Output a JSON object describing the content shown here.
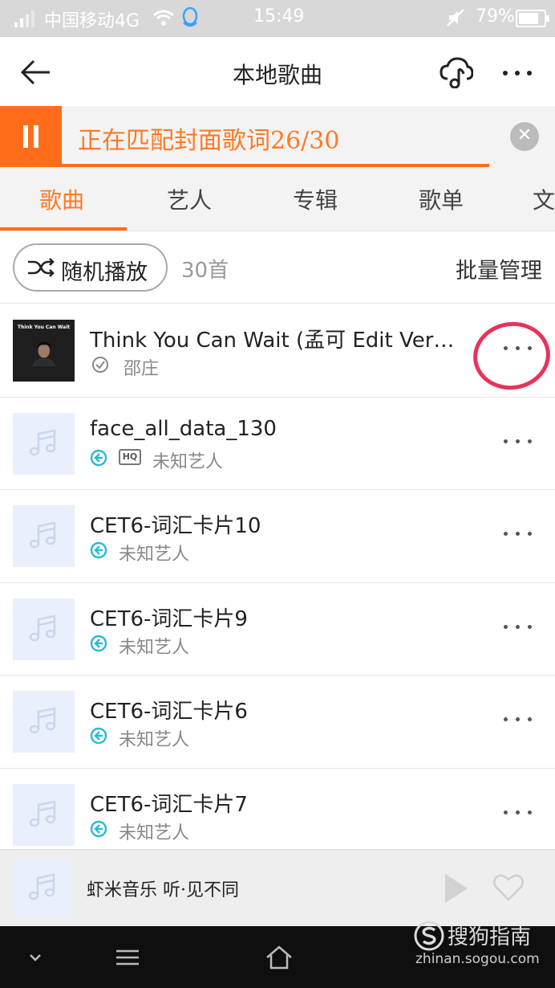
{
  "status_bar": {
    "carrier": "中国移动4G",
    "time": "15:49",
    "battery": "79%",
    "battery_level": 0.79
  },
  "header": {
    "title": "本地歌曲",
    "icons": [
      "back-arrow-icon",
      "cloud-music-icon",
      "more-icon"
    ]
  },
  "match_bar": {
    "text": "正在匹配封面歌词26/30",
    "progress": 0.867
  },
  "tabs": [
    {
      "label": "歌曲",
      "active": true
    },
    {
      "label": "艺人"
    },
    {
      "label": "专辑"
    },
    {
      "label": "歌单"
    },
    {
      "label": "文"
    }
  ],
  "toolbar": {
    "shuffle_label": "随机播放",
    "count": "30首",
    "batch_label": "批量管理"
  },
  "songs": [
    {
      "title": "Think You Can Wait (孟可 Edit Ver…",
      "artist": "邵庄",
      "cover_text": "Think You Can Wait",
      "status_icon": "check-icon",
      "hq": false
    },
    {
      "title": "face_all_data_130",
      "artist": "未知艺人",
      "status_icon": "local-icon",
      "hq": true,
      "hq_label": "HQ"
    },
    {
      "title": "CET6-词汇卡片10",
      "artist": "未知艺人",
      "status_icon": "local-icon",
      "hq": false
    },
    {
      "title": "CET6-词汇卡片9",
      "artist": "未知艺人",
      "status_icon": "local-icon",
      "hq": false
    },
    {
      "title": "CET6-词汇卡片6",
      "artist": "未知艺人",
      "status_icon": "local-icon",
      "hq": false
    },
    {
      "title": "CET6-词汇卡片7",
      "artist": "未知艺人",
      "status_icon": "local-icon",
      "hq": false
    }
  ],
  "player": {
    "slogan": "虾米音乐 听·见不同"
  },
  "watermark": {
    "name": "搜狗指南",
    "url": "zhinan.sogou.com"
  },
  "colors": {
    "accent": "#ff6d1a",
    "accent_text": "#ff7a24",
    "local_icon": "#2bb8d8",
    "annotation": "#e8335a"
  }
}
